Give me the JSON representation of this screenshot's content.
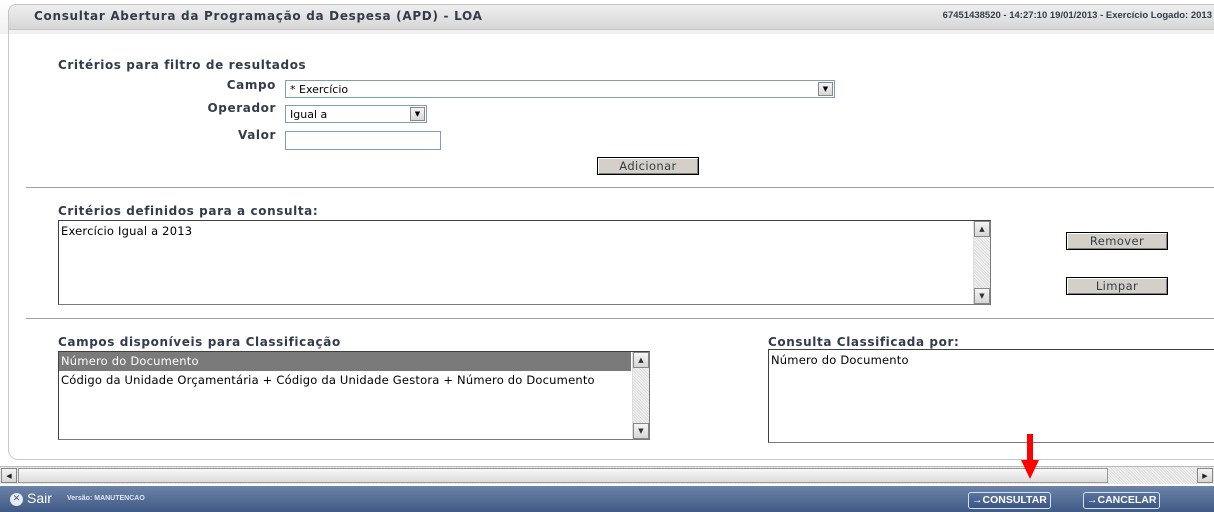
{
  "header": {
    "title": "Consultar Abertura da Programação da Despesa (APD) - LOA",
    "info": "67451438520 - 14:27:10 19/01/2013 - Exercício Logado: 2013"
  },
  "filtro": {
    "heading": "Critérios para filtro de resultados",
    "campo_label": "Campo",
    "campo_value": "* Exercício",
    "operador_label": "Operador",
    "operador_value": "Igual a",
    "valor_label": "Valor",
    "valor_value": "",
    "adicionar_label": "Adicionar"
  },
  "criterios": {
    "heading": "Critérios definidos para a consulta:",
    "items": [
      "Exercício Igual a 2013"
    ],
    "remover_label": "Remover",
    "limpar_label": "Limpar"
  },
  "classificacao": {
    "heading": "Campos disponíveis para Classificação",
    "items": [
      "Número do Documento",
      "Código da Unidade Orçamentária + Código da Unidade Gestora + Número do Documento"
    ],
    "selected_index": 0,
    "classificada_heading": "Consulta Classificada por:",
    "classificada_items": [
      "Número do Documento"
    ]
  },
  "footer": {
    "sair_label": "Sair",
    "versao_label": "Versão: MANUTENCAO",
    "consultar_label": "→CONSULTAR",
    "cancelar_label": "→CANCELAR"
  },
  "colors": {
    "footer_bg": "#3f5a85",
    "annotation_arrow": "#ff0000",
    "selection_bg": "#7a7a7a"
  },
  "icons": {
    "sair": "close-circle-icon",
    "dropdown": "triangle-down-icon",
    "scroll_up": "triangle-up-icon",
    "scroll_down": "triangle-down-icon",
    "scroll_left": "triangle-left-icon",
    "scroll_right": "triangle-right-icon",
    "annotation": "red-down-arrow-icon"
  }
}
